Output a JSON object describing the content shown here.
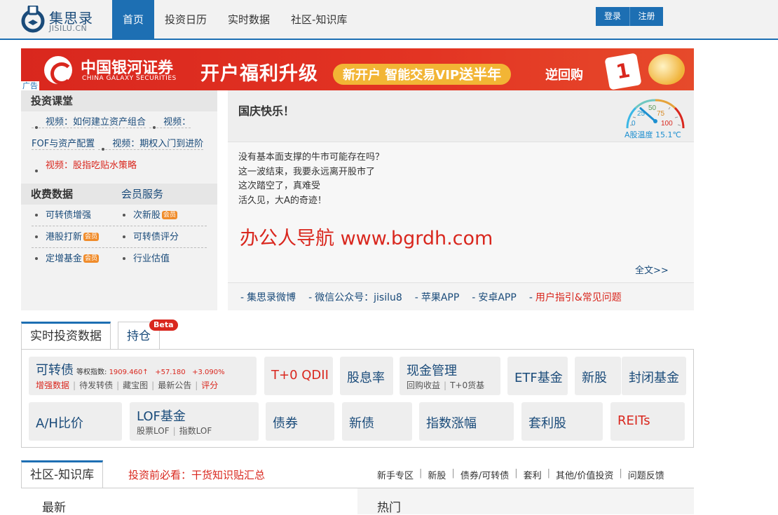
{
  "header": {
    "logo_cn": "集思录",
    "logo_en": "JISILU.CN",
    "nav": [
      {
        "label": "首页",
        "active": true
      },
      {
        "label": "投资日历",
        "active": false
      },
      {
        "label": "实时数据",
        "active": false
      },
      {
        "label": "社区-知识库",
        "active": false
      }
    ],
    "login_label": "登录",
    "register_label": "注册"
  },
  "banner": {
    "brand": "中国银河证券",
    "brand_en": "CHINA GALAXY SECURITIES",
    "slogan": "开户福利升级",
    "pill_text": "新开户 智能交易VIP",
    "pill_strong": "送半年",
    "cashback": "逆回购",
    "discount": "1折",
    "ad_label": "广告"
  },
  "courses": {
    "title": "投资课堂",
    "items": [
      {
        "label": "视频：如何建立资产组合",
        "hot": false
      },
      {
        "label": "视频：FOF与资产配置",
        "hot": false
      },
      {
        "label": "视频：期权入门到进阶",
        "hot": false
      },
      {
        "label": "视频：股指吃贴水策略",
        "hot": true
      }
    ]
  },
  "paid": {
    "title": "收费数据",
    "member_service": "会员服务",
    "member_badge": "会员",
    "rows": [
      [
        {
          "label": "可转债增强",
          "badge": false
        },
        {
          "label": "次新股",
          "badge": true
        }
      ],
      [
        {
          "label": "港股打新",
          "badge": true
        },
        {
          "label": "可转债评分",
          "badge": false
        }
      ],
      [
        {
          "label": "定增基金",
          "badge": true
        },
        {
          "label": "行业估值",
          "badge": false
        }
      ]
    ]
  },
  "notice": {
    "greeting": "国庆快乐！",
    "gauge": {
      "value": 15.1,
      "ticks": [
        "0",
        "25",
        "50",
        "75",
        "100"
      ],
      "label": "A股温度 15.1℃"
    },
    "news": [
      "没有基本面支撑的牛市可能存在吗？",
      "这一波结束，我要永远离开股市了",
      "这次踏空了，真难受",
      "活久见，大A的奇迹！"
    ],
    "watermark": "办公人导航 www.bgrdh.com",
    "full_text": "全文>>",
    "links": [
      {
        "label": "集思录微博",
        "red": false
      },
      {
        "label": "微信公众号：jisilu8",
        "red": false
      },
      {
        "label": "苹果APP",
        "red": false
      },
      {
        "label": "安卓APP",
        "red": false
      },
      {
        "label": "用户指引&常见问题",
        "red": true
      }
    ],
    "link_prefix": "-"
  },
  "realtime": {
    "tabs": [
      {
        "label": "实时投资数据",
        "active": true
      },
      {
        "label": "持仓",
        "active": false,
        "badge": "Beta"
      }
    ],
    "convertible": {
      "title": "可转债",
      "index_label": "等权指数:",
      "index_value": "1909.460↑",
      "change": "+57.180",
      "change_pct": "+3.090%",
      "links": [
        "增强数据",
        "待发转债",
        "藏宝图",
        "最新公告",
        "评分"
      ]
    },
    "tiles_row1": [
      {
        "label": "T+0 QDII",
        "red": true
      },
      {
        "label": "股息率"
      },
      {
        "label": "现金管理",
        "sub": [
          "回购收益",
          "T+0货基"
        ]
      },
      {
        "label": "ETF基金"
      },
      {
        "label": "新股"
      },
      {
        "label": "封闭基金"
      }
    ],
    "tiles_row2": [
      {
        "label": "A/H比价"
      },
      {
        "label": "LOF基金",
        "sub": [
          "股票LOF",
          "指数LOF"
        ]
      },
      {
        "label": "债券"
      },
      {
        "label": "新债"
      },
      {
        "label": "指数涨幅"
      },
      {
        "label": "套利股"
      },
      {
        "label": "REITs",
        "red": true
      }
    ]
  },
  "community": {
    "tab": "社区-知识库",
    "must_read": "投资前必看：干货知识贴汇总",
    "links": [
      "新手专区",
      "新股",
      "债券/可转债",
      "套利",
      "其他/价值投资",
      "问题反馈"
    ],
    "latest": "最新",
    "hot": "热门"
  },
  "colors": {
    "brand_blue": "#1d6fb3",
    "accent_red": "#d9271e",
    "banner_red": "#e33423"
  }
}
